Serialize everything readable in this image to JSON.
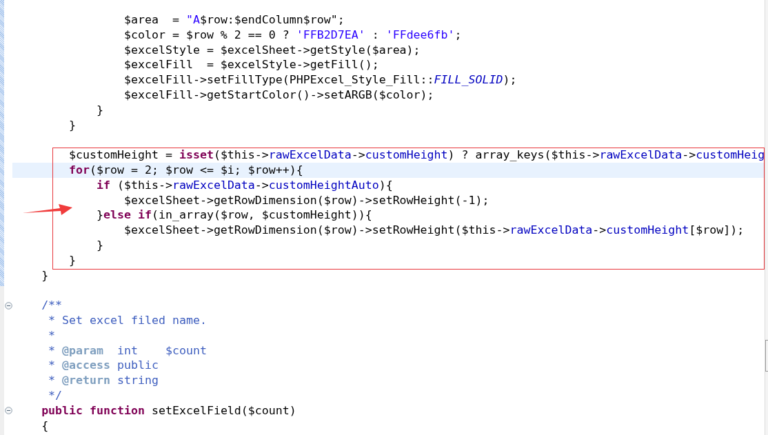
{
  "blocks": [
    {
      "kind": "plain",
      "lines": [
        {
          "current": false,
          "tokens": [
            {
              "t": "            $area  = ",
              "kind": "plain"
            },
            {
              "t": "\"A",
              "kind": "string"
            },
            {
              "t": "$row:$endColumn$row",
              "kind": "plain"
            },
            {
              "t": "\";",
              "kind": "plain"
            }
          ]
        },
        {
          "current": false,
          "tokens": [
            {
              "t": "            $color = $row % 2 == 0 ? ",
              "kind": "plain"
            },
            {
              "t": "'FFB2D7EA'",
              "kind": "string"
            },
            {
              "t": " : ",
              "kind": "plain"
            },
            {
              "t": "'FFdee6fb'",
              "kind": "string"
            },
            {
              "t": ";",
              "kind": "plain"
            }
          ]
        },
        {
          "current": false,
          "tokens": [
            {
              "t": "            $excelStyle = $excelSheet->getStyle($area);",
              "kind": "plain"
            }
          ]
        },
        {
          "current": false,
          "tokens": [
            {
              "t": "            $excelFill  = $excelStyle->getFill();",
              "kind": "plain"
            }
          ]
        },
        {
          "current": false,
          "tokens": [
            {
              "t": "            $excelFill->setFillType(PHPExcel_Style_Fill::",
              "kind": "plain"
            },
            {
              "t": "FILL_SOLID",
              "kind": "constant"
            },
            {
              "t": ");",
              "kind": "plain"
            }
          ]
        },
        {
          "current": false,
          "tokens": [
            {
              "t": "            $excelFill->getStartColor()->setARGB($color);",
              "kind": "plain"
            }
          ]
        },
        {
          "current": false,
          "tokens": [
            {
              "t": "        }",
              "kind": "plain"
            }
          ]
        },
        {
          "current": false,
          "tokens": [
            {
              "t": "    }",
              "kind": "plain"
            }
          ]
        },
        {
          "current": false
        }
      ]
    },
    {
      "kind": "boxed",
      "lines": [
        {
          "current": false,
          "tokens": [
            {
              "t": "    $customHeight = ",
              "kind": "plain"
            },
            {
              "t": "isset",
              "kind": "keyword"
            },
            {
              "t": "($this->",
              "kind": "plain"
            },
            {
              "t": "rawExcelData",
              "kind": "field"
            },
            {
              "t": "->",
              "kind": "plain"
            },
            {
              "t": "customHeight",
              "kind": "field"
            },
            {
              "t": ") ? array_keys($this->",
              "kind": "plain"
            },
            {
              "t": "rawExcelData",
              "kind": "field"
            },
            {
              "t": "->",
              "kind": "plain"
            },
            {
              "t": "customHeig",
              "kind": "field"
            }
          ]
        },
        {
          "current": true,
          "tokens": [
            {
              "t": "    for",
              "kind": "keyword"
            },
            {
              "t": "($row = 2; $row <= $i; $row++){",
              "kind": "plain"
            }
          ]
        },
        {
          "current": false,
          "tokens": [
            {
              "t": "        if",
              "kind": "keyword"
            },
            {
              "t": " ($this->",
              "kind": "plain"
            },
            {
              "t": "rawExcelData",
              "kind": "field"
            },
            {
              "t": "->",
              "kind": "plain"
            },
            {
              "t": "customHeightAuto",
              "kind": "field"
            },
            {
              "t": "){",
              "kind": "plain"
            }
          ]
        },
        {
          "current": false,
          "tokens": [
            {
              "t": "            $excelSheet->getRowDimension($row)->setRowHeight(-1);",
              "kind": "plain"
            }
          ]
        },
        {
          "current": false,
          "tokens": [
            {
              "t": "        }",
              "kind": "plain"
            },
            {
              "t": "else if",
              "kind": "keyword"
            },
            {
              "t": "(in_array($row, $customHeight)){",
              "kind": "plain"
            }
          ]
        },
        {
          "current": false,
          "tokens": [
            {
              "t": "            $excelSheet->getRowDimension($row)->setRowHeight($this->",
              "kind": "plain"
            },
            {
              "t": "rawExcelData",
              "kind": "field"
            },
            {
              "t": "->",
              "kind": "plain"
            },
            {
              "t": "customHeight",
              "kind": "field"
            },
            {
              "t": "[$row]);",
              "kind": "plain"
            }
          ]
        },
        {
          "current": false,
          "tokens": [
            {
              "t": "        }",
              "kind": "plain"
            }
          ]
        },
        {
          "current": false,
          "tokens": [
            {
              "t": "    }",
              "kind": "plain"
            }
          ]
        }
      ]
    },
    {
      "kind": "plain",
      "lines": [
        {
          "current": false,
          "tokens": [
            {
              "t": "}",
              "kind": "plain"
            }
          ]
        },
        {
          "current": false
        },
        {
          "current": false,
          "fold": {
            "expanded": true
          },
          "tokens": [
            {
              "t": "/**",
              "kind": "comment"
            }
          ]
        },
        {
          "current": false,
          "tokens": [
            {
              "t": " * Set excel filed name.",
              "kind": "comment"
            }
          ]
        },
        {
          "current": false,
          "tokens": [
            {
              "t": " *",
              "kind": "comment"
            }
          ]
        },
        {
          "current": false,
          "tokens": [
            {
              "t": " * ",
              "kind": "comment"
            },
            {
              "t": "@param",
              "kind": "doctag"
            },
            {
              "t": "  int    $count",
              "kind": "comment"
            }
          ]
        },
        {
          "current": false,
          "tokens": [
            {
              "t": " * ",
              "kind": "comment"
            },
            {
              "t": "@access",
              "kind": "doctag"
            },
            {
              "t": " public",
              "kind": "comment"
            }
          ]
        },
        {
          "current": false,
          "tokens": [
            {
              "t": " * ",
              "kind": "comment"
            },
            {
              "t": "@return",
              "kind": "doctag"
            },
            {
              "t": " string",
              "kind": "comment"
            }
          ]
        },
        {
          "current": false,
          "tokens": [
            {
              "t": " */",
              "kind": "comment"
            }
          ]
        },
        {
          "current": false,
          "fold": {
            "expanded": true
          },
          "tokens": [
            {
              "t": "public function",
              "kind": "keyword"
            },
            {
              "t": " setExcelField($count)",
              "kind": "plain"
            }
          ]
        },
        {
          "current": false,
          "tokens": [
            {
              "t": "{",
              "kind": "plain"
            }
          ]
        }
      ]
    }
  ]
}
